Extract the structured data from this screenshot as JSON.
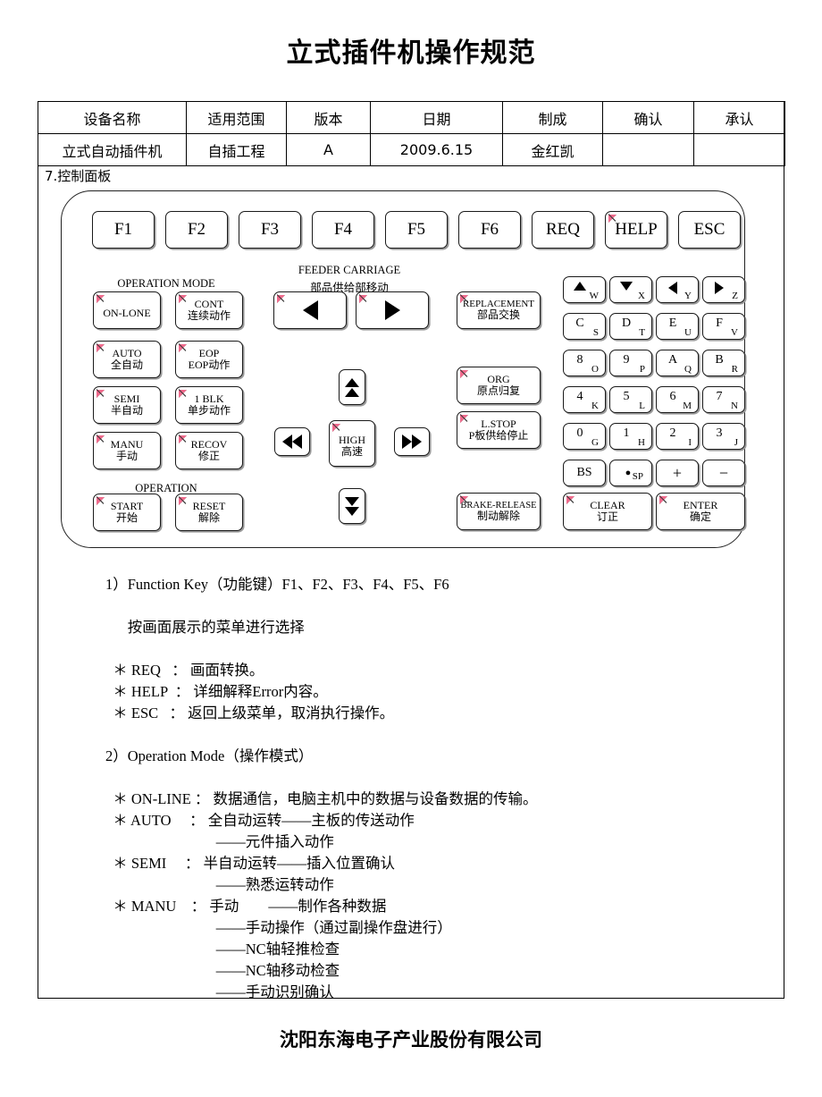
{
  "document": {
    "title": "立式插件机操作规范",
    "footer": "沈阳东海电子产业股份有限公司",
    "section_heading": "7.控制面板"
  },
  "header_table": {
    "columns": [
      "设备名称",
      "适用范围",
      "版本",
      "日期",
      "制成",
      "确认",
      "承认"
    ],
    "values": [
      "立式自动插件机",
      "自插工程",
      "A",
      "2009.6.15",
      "金红凯",
      "",
      ""
    ]
  },
  "control_panel": {
    "function_keys": [
      {
        "label": "F1",
        "led": false
      },
      {
        "label": "F2",
        "led": false
      },
      {
        "label": "F3",
        "led": false
      },
      {
        "label": "F4",
        "led": false
      },
      {
        "label": "F5",
        "led": false
      },
      {
        "label": "F6",
        "led": false
      },
      {
        "label": "REQ",
        "led": false
      },
      {
        "label": "HELP",
        "led": true
      },
      {
        "label": "ESC",
        "led": false
      }
    ],
    "group_captions": {
      "operation_mode": "OPERATION MODE",
      "operation": "OPERATION",
      "feeder_carriage_en": "FEEDER CARRIAGE",
      "feeder_carriage_cn": "部品供给部移动"
    },
    "mode_keys": [
      {
        "l1": "ON-LONE",
        "l2": "",
        "led": true
      },
      {
        "l1": "CONT",
        "l2": "连续动作",
        "led": true
      },
      {
        "l1": "AUTO",
        "l2": "全自动",
        "led": true
      },
      {
        "l1": "EOP",
        "l2": "EOP动作",
        "led": true
      },
      {
        "l1": "SEMI",
        "l2": "半自动",
        "led": true
      },
      {
        "l1": "1 BLK",
        "l2": "单步动作",
        "led": true
      },
      {
        "l1": "MANU",
        "l2": "手动",
        "led": true
      },
      {
        "l1": "RECOV",
        "l2": "修正",
        "led": true
      },
      {
        "l1": "START",
        "l2": "开始",
        "led": true
      },
      {
        "l1": "RESET",
        "l2": "解除",
        "led": true
      }
    ],
    "feeder_keys": [
      {
        "icon": "triangle-left-icon",
        "led": true
      },
      {
        "icon": "triangle-right-icon",
        "led": true
      }
    ],
    "jog_keys": [
      {
        "icon": "double-arrow-up-icon",
        "led": false
      },
      {
        "icon": "double-arrow-left-icon",
        "led": false
      },
      {
        "l1": "HIGH",
        "l2": "高速",
        "led": true
      },
      {
        "icon": "double-arrow-right-icon",
        "led": false
      },
      {
        "icon": "double-arrow-down-icon",
        "led": false
      }
    ],
    "action_keys": [
      {
        "l1": "REPLACEMENT",
        "l2": "部品交换",
        "led": true
      },
      {
        "l1": "ORG",
        "l2": "原点归复",
        "led": true
      },
      {
        "l1": "L.STOP",
        "l2": "P板供给停止",
        "led": true
      },
      {
        "l1": "BRAKE-RELEASE",
        "l2": "制动解除",
        "led": true
      }
    ],
    "keypad": [
      {
        "main": "▲",
        "sub": "W",
        "icon": "arrow-up-icon"
      },
      {
        "main": "▼",
        "sub": "X",
        "icon": "arrow-down-icon"
      },
      {
        "main": "◀",
        "sub": "Y",
        "icon": "arrow-left-icon"
      },
      {
        "main": "▶",
        "sub": "Z",
        "icon": "arrow-right-icon"
      },
      {
        "main": "C",
        "sub": "S"
      },
      {
        "main": "D",
        "sub": "T"
      },
      {
        "main": "E",
        "sub": "U"
      },
      {
        "main": "F",
        "sub": "V"
      },
      {
        "main": "8",
        "sub": "O"
      },
      {
        "main": "9",
        "sub": "P"
      },
      {
        "main": "A",
        "sub": "Q"
      },
      {
        "main": "B",
        "sub": "R"
      },
      {
        "main": "4",
        "sub": "K"
      },
      {
        "main": "5",
        "sub": "L"
      },
      {
        "main": "6",
        "sub": "M"
      },
      {
        "main": "7",
        "sub": "N"
      },
      {
        "main": "0",
        "sub": "G"
      },
      {
        "main": "1",
        "sub": "H"
      },
      {
        "main": "2",
        "sub": "I"
      },
      {
        "main": "3",
        "sub": "J"
      },
      {
        "main": "BS",
        "sub": ""
      },
      {
        "main": "●",
        "sub": "SP"
      },
      {
        "main": "+",
        "sub": ""
      },
      {
        "main": "−",
        "sub": ""
      }
    ],
    "keypad_bottom": [
      {
        "l1": "CLEAR",
        "l2": "订正",
        "led": true
      },
      {
        "l1": "ENTER",
        "l2": "确定",
        "led": true
      }
    ],
    "led_color": "#f06a8c"
  },
  "body_text": {
    "lines": [
      "1）Function Key（功能键）F1、F2、F3、F4、F5、F6",
      "",
      "      按画面展示的菜单进行选择",
      "",
      "  ＊ REQ   ： 画面转换。",
      "  ＊ HELP  ： 详细解释Error内容。",
      "  ＊ ESC   ： 返回上级菜单，取消执行操作。",
      "",
      "2）Operation Mode（操作模式）",
      "",
      "  ＊ ON-LINE ： 数据通信，电脑主机中的数据与设备数据的传输。",
      "  ＊ AUTO     ： 全自动运转——主板的传送动作",
      "                              ——元件插入动作",
      "  ＊ SEMI     ： 半自动运转——插入位置确认",
      "                              ——熟悉运转动作",
      "  ＊ MANU    ： 手动        ——制作各种数据",
      "                              ——手动操作（通过副操作盘进行）",
      "                              ——NC轴轻推检查",
      "                              ——NC轴移动检查",
      "                              ——手动识别确认"
    ]
  }
}
